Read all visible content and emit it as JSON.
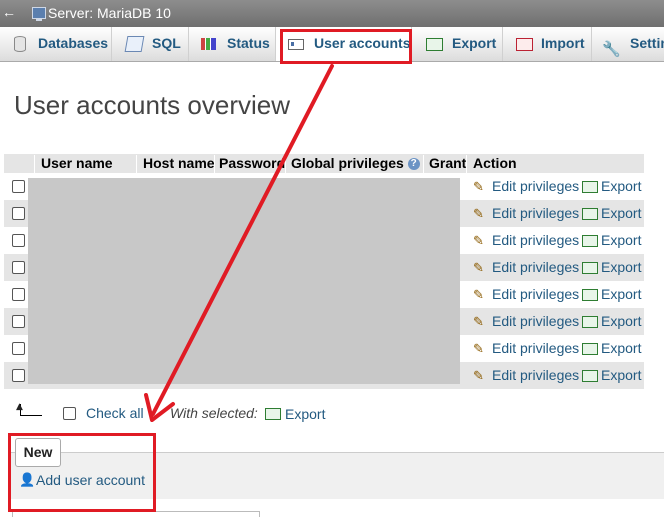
{
  "server_bar": {
    "back": "←",
    "title": "Server: MariaDB 10"
  },
  "tabs": [
    {
      "label": "Databases",
      "icon": "database-icon"
    },
    {
      "label": "SQL",
      "icon": "sql-icon"
    },
    {
      "label": "Status",
      "icon": "status-icon"
    },
    {
      "label": "User accounts",
      "icon": "users-icon",
      "active": true
    },
    {
      "label": "Export",
      "icon": "export-icon"
    },
    {
      "label": "Import",
      "icon": "import-icon"
    },
    {
      "label": "Settin",
      "icon": "wrench-icon"
    }
  ],
  "page_title": "User accounts overview",
  "table": {
    "headers": [
      "User name",
      "Host name",
      "Password",
      "Global privileges",
      "Grant",
      "Action"
    ],
    "help_glyph": "?",
    "row_count": 8,
    "edit_label": "Edit privileges",
    "export_label": "Export"
  },
  "bottom": {
    "check_all": "Check all",
    "with_selected": "With selected:",
    "export_label": "Export"
  },
  "new_section": {
    "legend": "New",
    "add_user": "Add user account"
  },
  "annotation_color": "#e01b24"
}
